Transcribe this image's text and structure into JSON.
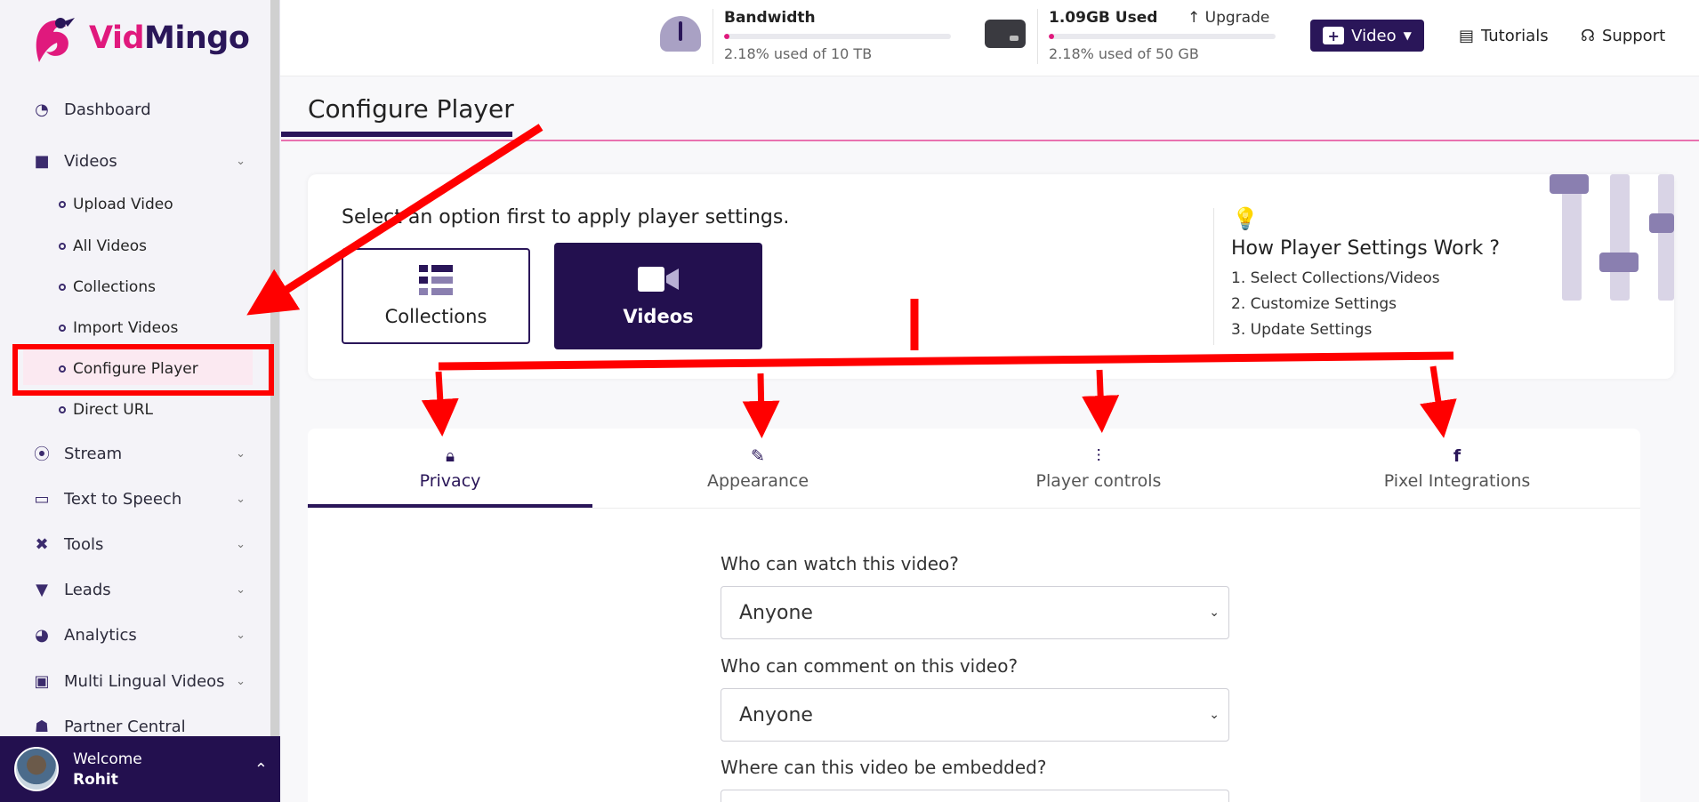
{
  "brand": {
    "name_part1": "Vid",
    "name_part2": "Mingo"
  },
  "sidebar": {
    "items": [
      {
        "label": "Dashboard",
        "icon": "dashboard-icon"
      },
      {
        "label": "Videos",
        "icon": "video-camera-icon"
      },
      {
        "label": "Stream",
        "icon": "broadcast-icon"
      },
      {
        "label": "Text to Speech",
        "icon": "speech-bubble-icon"
      },
      {
        "label": "Tools",
        "icon": "tools-icon"
      },
      {
        "label": "Leads",
        "icon": "filter-icon"
      },
      {
        "label": "Analytics",
        "icon": "pie-chart-icon"
      },
      {
        "label": "Multi Lingual Videos",
        "icon": "translate-icon"
      },
      {
        "label": "Partner Central",
        "icon": "people-icon"
      }
    ],
    "video_subitems": [
      "Upload Video",
      "All Videos",
      "Collections",
      "Import Videos",
      "Configure Player",
      "Direct URL"
    ],
    "user": {
      "welcome": "Welcome",
      "name": "Rohit"
    }
  },
  "topbar": {
    "bandwidth": {
      "title": "Bandwidth",
      "usage": "2.18% used of 10 TB",
      "percent": 2.18
    },
    "storage": {
      "title": "1.09GB Used",
      "usage": "2.18% used of 50 GB",
      "percent": 2.18,
      "upgrade": "Upgrade"
    },
    "video_button": "Video",
    "tutorials": "Tutorials",
    "support": "Support"
  },
  "main": {
    "title": "Configure Player",
    "hint": "Select an option first to apply player settings.",
    "options": {
      "collections": "Collections",
      "videos": "Videos"
    },
    "how": {
      "title": "How Player Settings Work ?",
      "steps": [
        "1. Select Collections/Videos",
        "2. Customize Settings",
        "3. Update Settings"
      ]
    },
    "tabs": [
      "Privacy",
      "Appearance",
      "Player controls",
      "Pixel Integrations"
    ],
    "form": {
      "q1": "Who can watch this video?",
      "a1": "Anyone",
      "q2": "Who can comment on this video?",
      "a2": "Anyone",
      "q3": "Where can this video be embedded?"
    }
  },
  "colors": {
    "brand": "#2a1659",
    "accent": "#e0197d",
    "annotation": "#ff0000"
  }
}
